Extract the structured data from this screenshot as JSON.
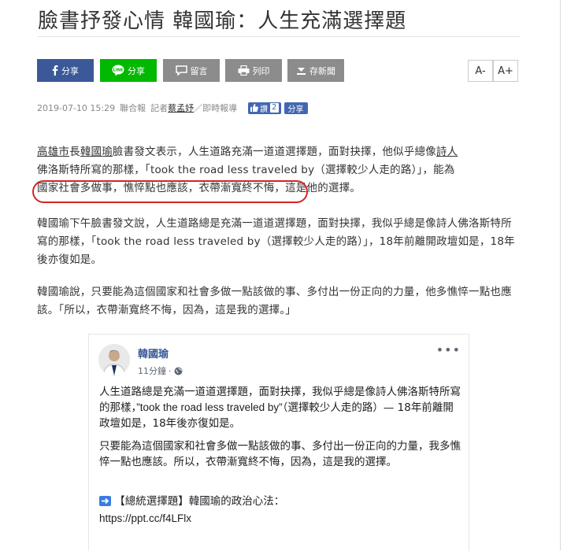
{
  "article": {
    "title": "臉書抒發心情 韓國瑜：人生充滿選擇題"
  },
  "toolbar": {
    "facebook": "分享",
    "line": "分享",
    "comment": "留言",
    "print": "列印",
    "save": "存新聞",
    "font_smaller": "A-",
    "font_larger": "A+"
  },
  "meta": {
    "date": "2019-07-10 15:29",
    "source": "聯合報",
    "reporter_prefix": "記者",
    "reporter": "蔡孟妤",
    "suffix": "／即時報導",
    "like_label": "讚",
    "like_count": "2",
    "share_label": "分享"
  },
  "paragraphs": {
    "p1_link1": "高雄市",
    "p1_t1": "長",
    "p1_link2": "韓國瑜",
    "p1_t2": "臉書發文表示，人生道路充滿一道道選擇題，面對抉擇，他似乎總像",
    "p1_link3": "詩人",
    "p1_line2": "佛洛斯特所寫的那樣，「took the road less traveled by（選擇較少人走的路）」，能為",
    "p1_line3a": "國家社會多做事，憔悴點也應該，衣帶漸寬終不悔",
    "p1_line3b": "，這是他的選擇。",
    "p2": "韓國瑜下午臉書發文說，人生道路總是充滿一道道選擇題，面對抉擇，我似乎總是像詩人佛洛斯特所寫的那樣，「took the road less traveled by（選擇較少人走的路）」，18年前離開政壇如是，18年後亦復如是。",
    "p3": "韓國瑜說，只要能為這個國家和社會多做一點該做的事、多付出一份正向的力量，他多憔悴一點也應該。「所以，衣帶漸寬終不悔，因為，這是我的選擇。」"
  },
  "post": {
    "author": "韓國瑜",
    "time": "11分鐘",
    "more": "•••",
    "text1a": "人生道路總是充滿一道道選擇題，面對抉擇，我似乎總是像詩人佛洛斯特所寫的那樣，",
    "text1_quote": "”took the road less traveled by”",
    "text1b": "（選擇較少人走的路）— 18年前離開政壇如是，18年後亦復如是。",
    "text2": "只要能為這個國家和社會多做一點該做的事、多付出一份正向的力量，我多憔悴一點也應該。所以，衣帶漸寬終不悔，因為，這是我的選擇。",
    "link_label": "【總統選擇題】韓國瑜的政治心法：",
    "link_url": "https://ppt.cc/f4LFlx"
  },
  "colors": {
    "facebook": "#3b5998",
    "line": "#00b900",
    "grey_button": "#8c8c8c",
    "highlight_oval": "#d42424",
    "fb_link": "#385898"
  }
}
